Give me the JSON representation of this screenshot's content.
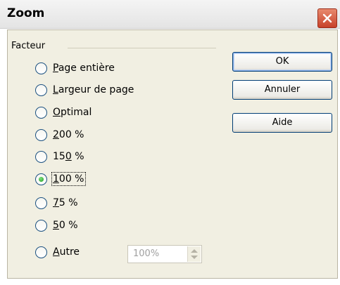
{
  "window": {
    "title": "Zoom"
  },
  "group": {
    "label": "Facteur"
  },
  "options": [
    {
      "pre": "",
      "mnemonic": "P",
      "post": "age entière"
    },
    {
      "pre": "",
      "mnemonic": "L",
      "post": "argeur de page"
    },
    {
      "pre": "",
      "mnemonic": "O",
      "post": "ptimal"
    },
    {
      "pre": "",
      "mnemonic": "2",
      "post": "00 %"
    },
    {
      "pre": "15",
      "mnemonic": "0",
      "post": " %"
    },
    {
      "pre": "",
      "mnemonic": "1",
      "post": "00 %"
    },
    {
      "pre": "",
      "mnemonic": "7",
      "post": "5 %"
    },
    {
      "pre": "",
      "mnemonic": "5",
      "post": "0 %"
    },
    {
      "pre": "",
      "mnemonic": "A",
      "post": "utre"
    }
  ],
  "selected_option": "100 %",
  "custom_zoom": {
    "value": "100%"
  },
  "buttons": {
    "ok": "OK",
    "cancel": "Annuler",
    "help": "Aide"
  }
}
